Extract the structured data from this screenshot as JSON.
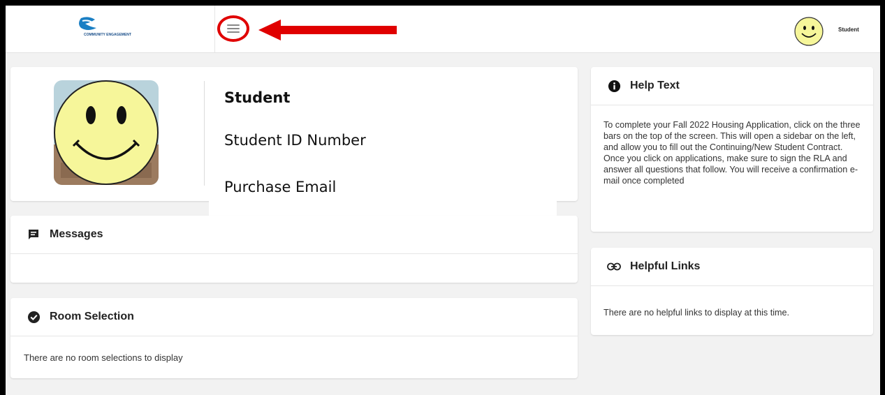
{
  "header": {
    "logo_text": "COMMUNITY ENGAGEMENT",
    "user_name": "Student",
    "menu_icon": "hamburger-menu-icon",
    "annotation_color": "#e00000"
  },
  "profile": {
    "name": "Student",
    "id_label": "Student ID Number",
    "email_label": "Purchase Email"
  },
  "messages": {
    "title": "Messages",
    "icon": "message-icon"
  },
  "room_selection": {
    "title": "Room Selection",
    "icon": "check-circle-icon",
    "empty_text": "There are no room selections to display"
  },
  "help_text": {
    "title": "Help Text",
    "icon": "info-icon",
    "body": "To complete your Fall 2022 Housing Application, click on the three bars on the top of the screen. This will open a sidebar on the left, and allow you to fill out the Continuing/New Student Contract. Once you click on applications, make sure to sign the RLA and answer all questions that follow. You will receive a confirmation e-mail once completed"
  },
  "helpful_links": {
    "title": "Helpful Links",
    "icon": "link-icon",
    "empty_text": "There are no helpful links to display at this time."
  }
}
